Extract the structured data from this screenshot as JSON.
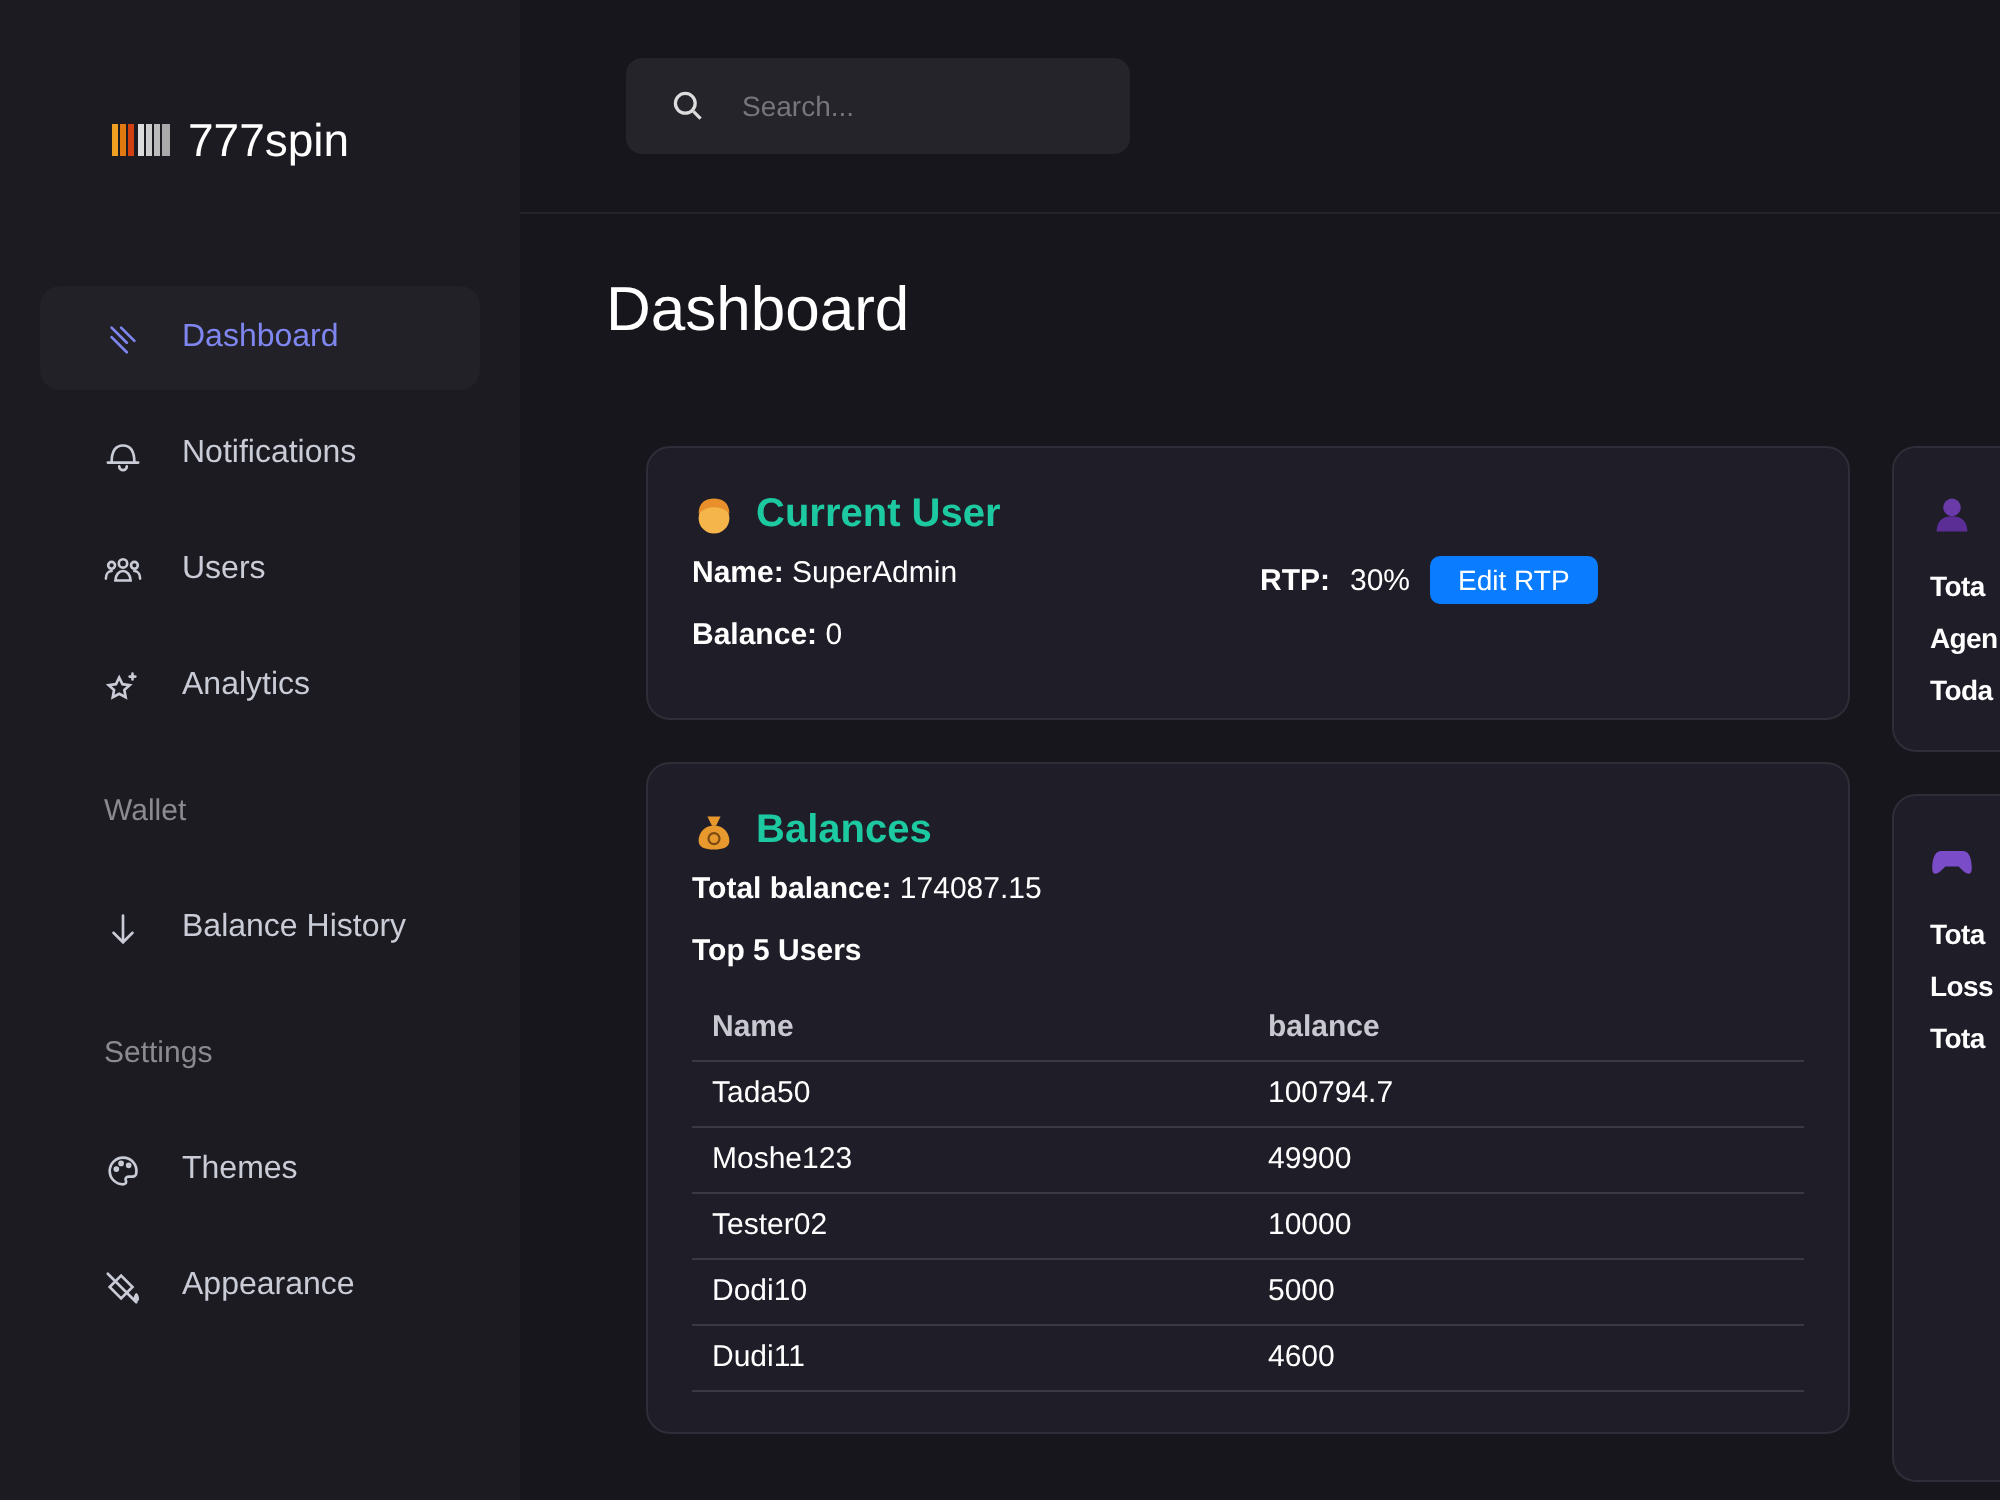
{
  "brand": {
    "name": "777spin"
  },
  "sidebar": {
    "sections": [
      {
        "items": [
          {
            "label": "Dashboard",
            "selected": true
          },
          {
            "label": "Notifications",
            "selected": false
          },
          {
            "label": "Users",
            "selected": false
          },
          {
            "label": "Analytics",
            "selected": false
          }
        ]
      },
      {
        "title": "Wallet",
        "items": [
          {
            "label": "Balance History",
            "selected": false
          }
        ]
      },
      {
        "title": "Settings",
        "items": [
          {
            "label": "Themes",
            "selected": false
          },
          {
            "label": "Appearance",
            "selected": false
          }
        ]
      }
    ]
  },
  "search": {
    "placeholder": "Search..."
  },
  "page_title": "Dashboard",
  "current_user": {
    "title": "Current User",
    "name_label": "Name:",
    "name": "SuperAdmin",
    "balance_label": "Balance:",
    "balance": "0",
    "rtp_label": "RTP:",
    "rtp": "30%",
    "edit_button": "Edit RTP"
  },
  "balances": {
    "title": "Balances",
    "total_label": "Total balance:",
    "total": "174087.15",
    "top_title": "Top 5 Users",
    "columns": [
      "Name",
      "balance"
    ],
    "rows": [
      [
        "Tada50",
        "100794.7"
      ],
      [
        "Moshe123",
        "49900"
      ],
      [
        "Tester02",
        "10000"
      ],
      [
        "Dodi10",
        "5000"
      ],
      [
        "Dudi11",
        "4600"
      ]
    ]
  },
  "side_cards": [
    {
      "lines": [
        "Tota",
        "Agen",
        "Toda"
      ]
    },
    {
      "lines": [
        "Tota",
        "Loss",
        "Tota"
      ]
    }
  ]
}
